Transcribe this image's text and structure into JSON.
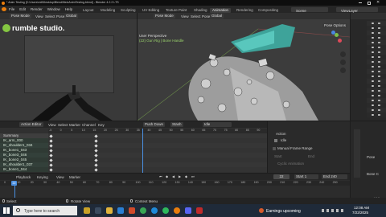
{
  "titlebar": {
    "title": "* Anim Testing [C:\\Users\\mtt\\Desktop\\Blend\\files\\AnimTesting.blend] - Blender 4.2.2 LTS"
  },
  "menubar": {
    "items": [
      "File",
      "Edit",
      "Render",
      "Window",
      "Help"
    ]
  },
  "workspaces": [
    {
      "label": "Layout",
      "active": false
    },
    {
      "label": "Modeling",
      "active": false
    },
    {
      "label": "Sculpting",
      "active": false
    },
    {
      "label": "UV Editing",
      "active": false
    },
    {
      "label": "Texture Paint",
      "active": false
    },
    {
      "label": "Shading",
      "active": false
    },
    {
      "label": "Animation",
      "active": true
    },
    {
      "label": "Rendering",
      "active": false
    },
    {
      "label": "Compositing",
      "active": false
    }
  ],
  "scene": {
    "scene_label": "Scene",
    "view_layer": "ViewLayer"
  },
  "left_viewport": {
    "mode": "Pose Mode",
    "view": "View",
    "select": "Select",
    "pose": "Pose",
    "transform": "Global"
  },
  "watermark": {
    "text": "rumble studio."
  },
  "main_viewport": {
    "mode": "Pose Mode",
    "view": "View",
    "select": "Select",
    "pose": "Pose",
    "transform": "Global",
    "perspective": "User Perspective",
    "object_info": "(22) Gun Rig | Bone Handle",
    "options": "Pose Options"
  },
  "dopesheet": {
    "mode": "Action Editor",
    "view": "View",
    "select": "Select",
    "marker": "Marker",
    "channel": "Channel",
    "key": "Key",
    "push_down": "Push Down",
    "stash": "Stash",
    "action_name": "Idle",
    "ticks": [
      "-5",
      "0",
      "5",
      "10",
      "15",
      "20",
      "25",
      "30",
      "35",
      "40",
      "45",
      "50",
      "55",
      "60",
      "65",
      "70",
      "75",
      "80",
      "85",
      "90"
    ],
    "channels": [
      {
        "label": "Summary",
        "selected": false,
        "summary": true
      },
      {
        "label": "IK_arm_000",
        "selected": true
      },
      {
        "label": "IK_shoulder1_034",
        "selected": true
      },
      {
        "label": "IK_bone1_043",
        "selected": true
      },
      {
        "label": "IK_bone3_046",
        "selected": true
      },
      {
        "label": "IK_bone2_045",
        "selected": true
      },
      {
        "label": "IK_shoulder1_037",
        "selected": true
      },
      {
        "label": "IK_bone1_044",
        "selected": true
      }
    ]
  },
  "properties": {
    "action_header": "Action",
    "action_name": "Idle",
    "manual_frame_range": "Manual Frame Range",
    "start_label": "Start",
    "end_label": "End",
    "cyclic": "Cyclic Animation",
    "side_items": [
      "Pose",
      "Bone C"
    ]
  },
  "timeline": {
    "playback": "Playback",
    "keying": "Keying",
    "view": "View",
    "marker": "Marker",
    "current_frame": "22",
    "start_label": "Start",
    "start": "1",
    "end_label": "End",
    "end": "240",
    "ticks": [
      "0",
      "10",
      "20",
      "30",
      "40",
      "50",
      "60",
      "70",
      "80",
      "90",
      "100",
      "110",
      "120",
      "130",
      "140",
      "150",
      "160",
      "170",
      "180",
      "190",
      "200",
      "210",
      "220",
      "230",
      "240",
      "250"
    ]
  },
  "statusbar": {
    "select": "Select",
    "rotate": "Rotate View",
    "context": "Context Menu",
    "version": "4.2.2"
  },
  "taskbar": {
    "search_placeholder": "Type here to search",
    "notification": "Earnings upcoming",
    "time": "12:08 AM",
    "date": "7/22/2025"
  }
}
